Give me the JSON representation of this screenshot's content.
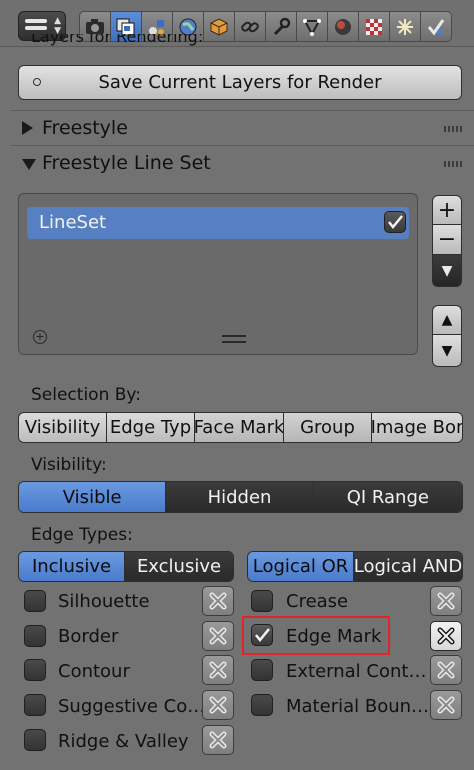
{
  "header": {
    "tabs": [
      {
        "icon": "camera-icon"
      },
      {
        "icon": "render-layers-icon",
        "active": true
      },
      {
        "icon": "scene-icon"
      },
      {
        "icon": "world-icon"
      },
      {
        "icon": "object-icon"
      },
      {
        "icon": "constraint-icon"
      },
      {
        "icon": "modifier-wrench-icon"
      },
      {
        "icon": "mesh-data-icon"
      },
      {
        "icon": "material-icon"
      },
      {
        "icon": "texture-icon"
      },
      {
        "icon": "particles-icon"
      },
      {
        "icon": "physics-icon"
      }
    ]
  },
  "layers_panel": {
    "partial_title": "Layers for Rendering:",
    "save_button": "Save Current Layers for Render"
  },
  "freestyle_panel": {
    "title": "Freestyle",
    "expanded": false
  },
  "lineset_panel": {
    "title": "Freestyle Line Set",
    "expanded": true,
    "items": [
      {
        "name": "LineSet",
        "enabled": true
      }
    ],
    "side_buttons": {
      "add": "+",
      "remove": "−",
      "menu": "▼",
      "up": "▲",
      "down": "▼"
    }
  },
  "selection": {
    "label": "Selection By:",
    "options": [
      {
        "label": "Visibility",
        "selected": false
      },
      {
        "label": "Edge Typ",
        "selected": false
      },
      {
        "label": "Face Mark",
        "selected": true
      },
      {
        "label": "Group",
        "selected": true
      },
      {
        "label": "Image Bor",
        "selected": false
      }
    ]
  },
  "visibility": {
    "label": "Visibility:",
    "options": [
      {
        "label": "Visible",
        "selected": true
      },
      {
        "label": "Hidden",
        "selected": false
      },
      {
        "label": "QI Range",
        "selected": false
      }
    ]
  },
  "edge_types": {
    "label": "Edge Types:",
    "mode_options": [
      {
        "label": "Inclusive",
        "selected": true
      },
      {
        "label": "Exclusive",
        "selected": false
      }
    ],
    "logic_options": [
      {
        "label": "Logical OR",
        "selected": true
      },
      {
        "label": "Logical AND",
        "selected": false
      }
    ],
    "left": [
      {
        "label": "Silhouette",
        "checked": false
      },
      {
        "label": "Border",
        "checked": false
      },
      {
        "label": "Contour",
        "checked": false
      },
      {
        "label": "Suggestive Co…",
        "checked": false
      },
      {
        "label": "Ridge & Valley",
        "checked": false
      }
    ],
    "right": [
      {
        "label": "Crease",
        "checked": false
      },
      {
        "label": "Edge Mark",
        "checked": true,
        "exclude_on": true
      },
      {
        "label": "External Cont…",
        "checked": false
      },
      {
        "label": "Material Boun…",
        "checked": false
      }
    ]
  },
  "colors": {
    "accent": "#5680c2",
    "highlight": "#e0262b",
    "background": "#727272"
  }
}
